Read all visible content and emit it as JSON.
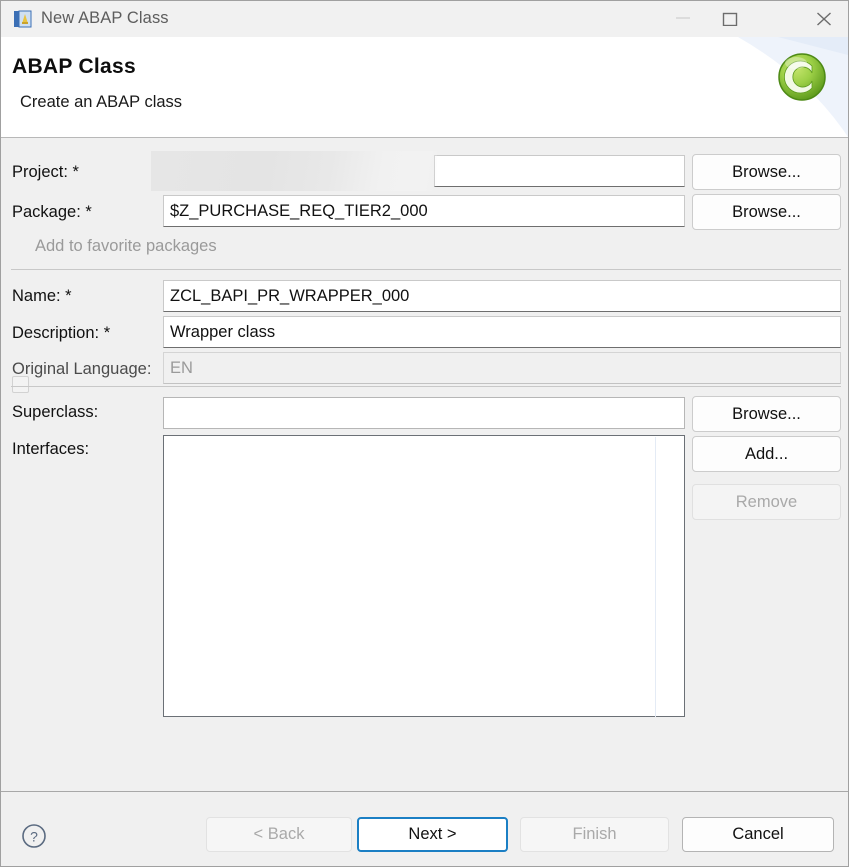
{
  "window": {
    "title": "New ABAP Class",
    "icon": "abap-class-wizard-icon",
    "minimize_label": "minimize-icon",
    "maximize_label": "maximize-icon",
    "close_label": "close-icon"
  },
  "header": {
    "title": "ABAP Class",
    "subtitle": "Create an ABAP class",
    "logo": "abap-class-green-c-icon"
  },
  "form": {
    "project": {
      "label": "Project: *",
      "value": "",
      "redacted": true,
      "browse_label": "Browse..."
    },
    "package": {
      "label": "Package: *",
      "value": "$Z_PURCHASE_REQ_TIER2_000",
      "browse_label": "Browse..."
    },
    "favorite": {
      "label": "Add to favorite packages",
      "checked": false,
      "enabled": false
    },
    "name": {
      "label": "Name: *",
      "value": "ZCL_BAPI_PR_WRAPPER_000"
    },
    "description": {
      "label": "Description: *",
      "value": "Wrapper class"
    },
    "original_language": {
      "label": "Original Language:",
      "value": "EN",
      "enabled": false
    },
    "superclass": {
      "label": "Superclass:",
      "value": "",
      "browse_label": "Browse..."
    },
    "interfaces": {
      "label": "Interfaces:",
      "items": [],
      "add_label": "Add...",
      "remove_label": "Remove",
      "remove_enabled": false
    }
  },
  "footer": {
    "help_label": "help-icon",
    "back_label": "< Back",
    "back_enabled": false,
    "next_label": "Next >",
    "next_enabled": true,
    "next_focused": true,
    "finish_label": "Finish",
    "finish_enabled": false,
    "cancel_label": "Cancel",
    "cancel_enabled": true
  },
  "colors": {
    "dialog_bg": "#f0f0f0",
    "header_bg": "#ffffff",
    "titlebar_bg": "#f1f1f1",
    "accent_focus": "#1b7fc4",
    "logo_green": "#8dc63f",
    "disabled_text": "#a9a9a9"
  }
}
